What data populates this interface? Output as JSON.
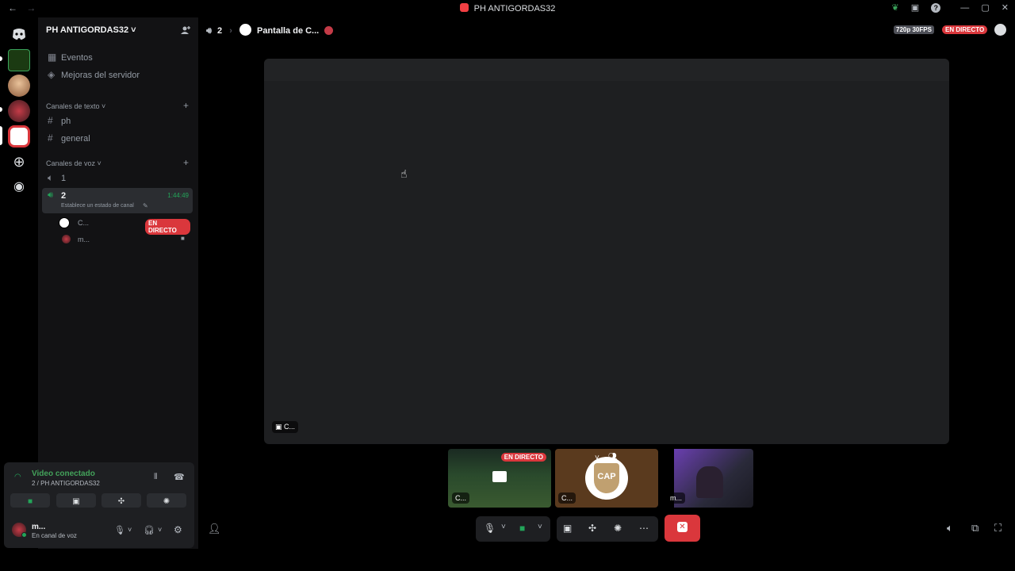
{
  "window": {
    "title": "PH ANTIGORDAS32",
    "back": "←",
    "forward": "→"
  },
  "colors": {
    "accent_green": "#23a559",
    "live_red": "#da373c",
    "panel_bg": "#121214"
  },
  "server": {
    "name": "PH ANTIGORDAS32 ˅"
  },
  "sidebar": {
    "events": "Eventos",
    "boosts": "Mejoras del servidor",
    "text_category": "Canales de texto ˅",
    "text_channels": [
      "ph",
      "general"
    ],
    "voice_category": "Canales de voz ˅",
    "voice_channel_1": "1",
    "voice_channel_2": "2",
    "voice_timer": "1:44:49",
    "voice_status_hint": "Establece un estado de canal",
    "members": [
      {
        "name": "C...",
        "badge": "EN DIRECTO"
      },
      {
        "name": "m..."
      }
    ]
  },
  "voice_panel": {
    "title": "Video conectado",
    "subtitle": "2 / PH ANTIGORDAS32"
  },
  "user": {
    "name": "m...",
    "status": "En canal de voz"
  },
  "stage": {
    "channel": "2",
    "stream_title": "Pantalla de C...",
    "quality": "720p 30FPS",
    "live": "EN DIRECTO",
    "main_label": "C...",
    "thumbs": [
      {
        "label": "C...",
        "badge": "EN DIRECTO"
      },
      {
        "label": "C...",
        "crest_text": "CAP"
      },
      {
        "label": "m..."
      }
    ]
  }
}
